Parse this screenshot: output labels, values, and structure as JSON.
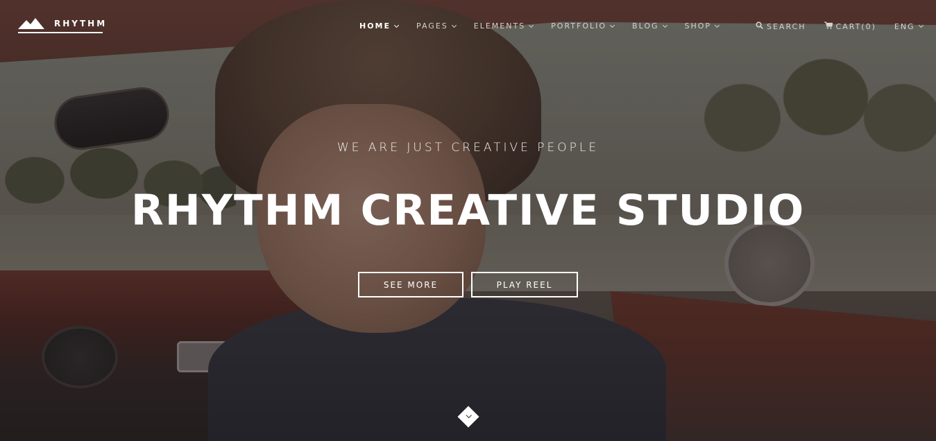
{
  "brand": {
    "name": "RHYTHM"
  },
  "nav": {
    "items": [
      {
        "label": "HOME",
        "active": true
      },
      {
        "label": "PAGES"
      },
      {
        "label": "ELEMENTS"
      },
      {
        "label": "PORTFOLIO"
      },
      {
        "label": "BLOG"
      },
      {
        "label": "SHOP"
      }
    ]
  },
  "tools": {
    "search_label": "SEARCH",
    "cart_label": "CART(0)",
    "lang_label": "ENG"
  },
  "hero": {
    "tagline": "WE ARE JUST CREATIVE PEOPLE",
    "headline": "RHYTHM CREATIVE STUDIO",
    "see_more_label": "SEE MORE",
    "play_reel_label": "PLAY REEL"
  },
  "icons": {
    "logo": "mountain-logo-icon",
    "search": "search-icon",
    "cart": "cart-icon",
    "scroll": "scroll-down-icon"
  },
  "colors": {
    "text": "#ffffff",
    "nav_text": "#d6d2ce",
    "overlay": "rgba(20,18,24,0.42)"
  }
}
